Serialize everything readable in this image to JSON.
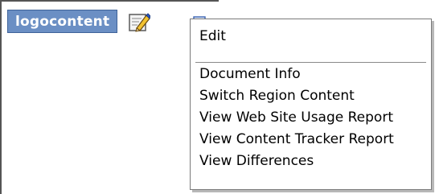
{
  "region": {
    "label": "logocontent",
    "edit_icon": "pencil-edit-icon",
    "menu_trigger_icon": "dropdown-menu-icon"
  },
  "menu": {
    "items": [
      {
        "label": "Edit"
      },
      {
        "label": "Document Info"
      },
      {
        "label": "Switch Region Content"
      },
      {
        "label": "View Web Site Usage Report"
      },
      {
        "label": "View Content Tracker Report"
      },
      {
        "label": "View Differences"
      }
    ]
  },
  "colors": {
    "label_background": "#6b8fc4",
    "label_text": "#ffffff",
    "menu_border": "#7a7a7a"
  }
}
